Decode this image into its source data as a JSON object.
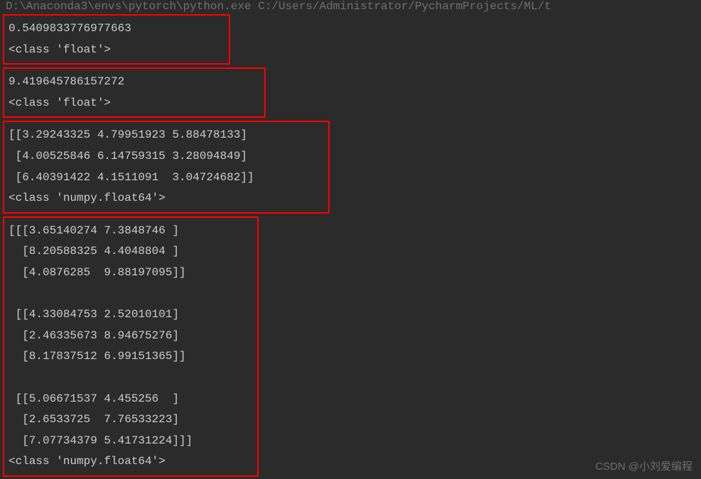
{
  "terminal": {
    "top_line": "D:\\Anaconda3\\envs\\pytorch\\python.exe C:/Users/Administrator/PycharmProjects/ML/t",
    "block1": "0.5409833776977663\n<class 'float'>",
    "block2": "9.419645786157272\n<class 'float'>",
    "block3": "[[3.29243325 4.79951923 5.88478133]\n [4.00525846 6.14759315 3.28094849]\n [6.40391422 4.1511091  3.04724682]]\n<class 'numpy.float64'>",
    "block4": "[[[3.65140274 7.3848746 ]\n  [8.20588325 4.4048804 ]\n  [4.0876285  9.88197095]]\n\n [[4.33084753 2.52010101]\n  [2.46335673 8.94675276]\n  [8.17837512 6.99151365]]\n\n [[5.06671537 4.455256  ]\n  [2.6533725  7.76533223]\n  [7.07734379 5.41731224]]]\n<class 'numpy.float64'>"
  },
  "watermark": "CSDN @小刘爱编程"
}
